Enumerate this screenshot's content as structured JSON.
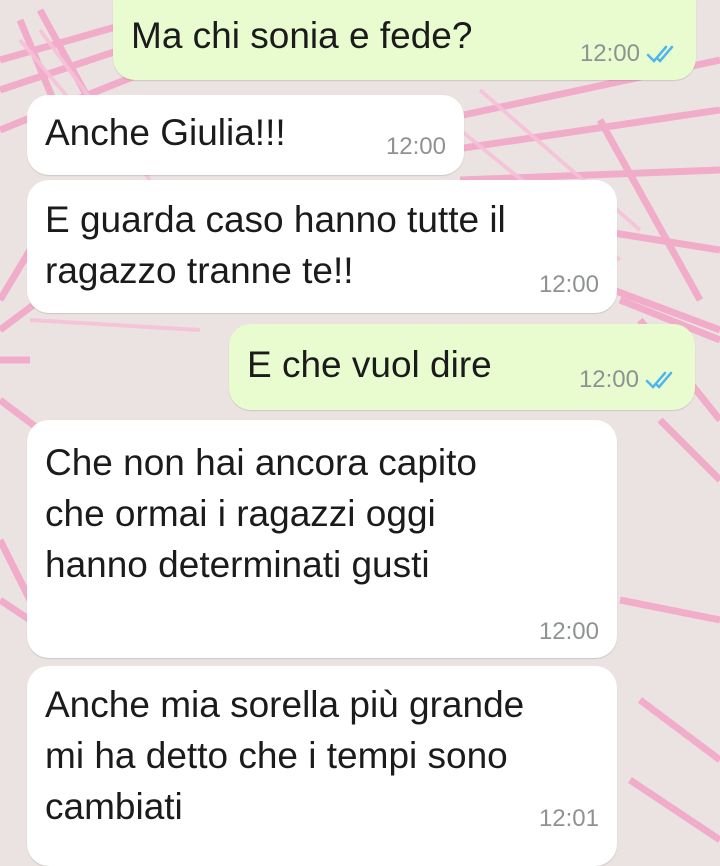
{
  "theme": {
    "background": "#ebe3e2",
    "incoming_bubble": "#ffffff",
    "outgoing_bubble": "#e8fcd0",
    "read_receipt": "#4fb6ec",
    "wallpaper_accent": "#f3a3c6"
  },
  "messages": [
    {
      "direction": "outgoing",
      "text": "Ma chi sonia e fede?",
      "time": "12:00",
      "status_icon": "double-check-read-icon"
    },
    {
      "direction": "incoming",
      "text": "Anche Giulia!!!",
      "time": "12:00"
    },
    {
      "direction": "incoming",
      "text": "E guarda caso hanno tutte il\nragazzo tranne te!!",
      "time": "12:00"
    },
    {
      "direction": "outgoing",
      "text": "E che vuol dire",
      "time": "12:00",
      "status_icon": "double-check-read-icon"
    },
    {
      "direction": "incoming",
      "text": "Che non hai ancora capito\nche ormai i ragazzi oggi\nhanno determinati gusti",
      "time": "12:00"
    },
    {
      "direction": "incoming",
      "text": "Anche mia sorella più grande\nmi ha detto che i tempi sono\ncambiati",
      "time": "12:01"
    }
  ]
}
